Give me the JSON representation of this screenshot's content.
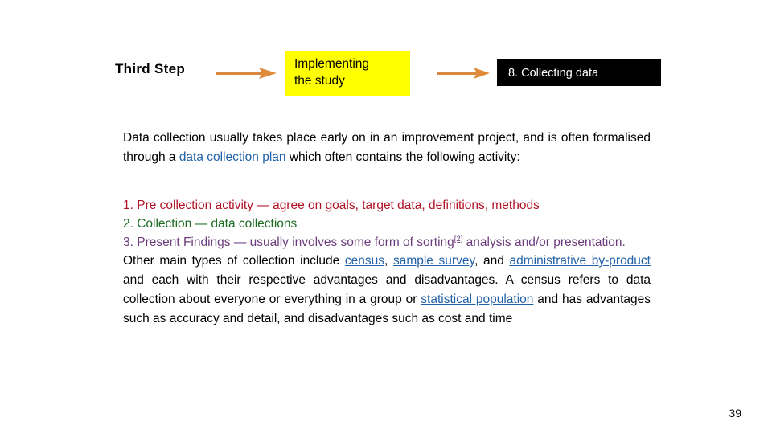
{
  "flow": {
    "step_label": "Third Step",
    "yellow_box": {
      "line1": "Implementing",
      "line2": "the study",
      "bg": "#ffff00"
    },
    "black_box": {
      "text": "8. Collecting data",
      "bg": "#000000",
      "fg": "#ffffff"
    },
    "arrow_color": "#dd8840"
  },
  "intro": {
    "part1": "Data collection usually takes place early on in an improvement project, and is often formalised through a ",
    "link1": "data collection plan",
    "part2": " which often contains the following activity:"
  },
  "list": {
    "item1": "1. Pre collection activity — agree on goals, target data, definitions, methods",
    "item2": "2. Collection — data collections",
    "item3_a": "3. Present Findings — usually involves some form of sorting",
    "item3_cite": "[2]",
    "item3_b": " analysis and/or presentation."
  },
  "other": {
    "a": "Other main types of collection include ",
    "link_census": "census",
    "b": ", ",
    "link_sample_survey": "sample survey",
    "c": ", and ",
    "link_admin": "administrative by-product",
    "d": " and each with their respective advantages and disadvantages. A census refers to data collection about everyone or everything in a group or ",
    "link_statpop": "statistical population",
    "e": " and has advantages such as accuracy and detail, and disadvantages such as cost and time"
  },
  "footer": {
    "page_number": "39"
  },
  "colors": {
    "link": "#2161a8",
    "item1": "#b01226",
    "item2": "#1b6b22",
    "item3": "#6c3c7d"
  }
}
